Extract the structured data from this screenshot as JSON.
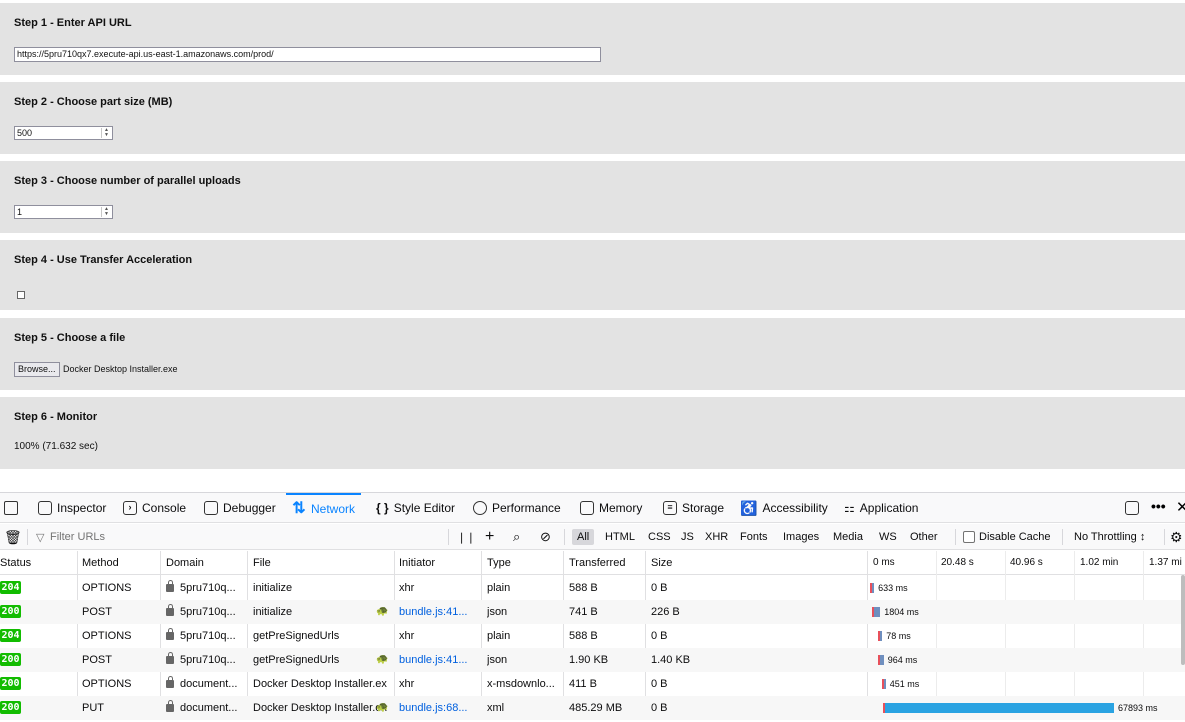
{
  "steps": {
    "s1": {
      "title": "Step 1 - Enter API URL",
      "url_value": "https://5pru710qx7.execute-api.us-east-1.amazonaws.com/prod/"
    },
    "s2": {
      "title": "Step 2 - Choose part size (MB)",
      "value": "500"
    },
    "s3": {
      "title": "Step 3 - Choose number of parallel uploads",
      "value": "1"
    },
    "s4": {
      "title": "Step 4 - Use Transfer Acceleration",
      "checked": false
    },
    "s5": {
      "title": "Step 5 - Choose a file",
      "browse_label": "Browse...",
      "file_name": "Docker Desktop Installer.exe"
    },
    "s6": {
      "title": "Step 6 - Monitor",
      "progress": "100% (71.632 sec)"
    }
  },
  "devtools": {
    "tabs": {
      "inspector": "Inspector",
      "console": "Console",
      "debugger": "Debugger",
      "network": "Network",
      "style_editor": "Style Editor",
      "performance": "Performance",
      "memory": "Memory",
      "storage": "Storage",
      "accessibility": "Accessibility",
      "application": "Application"
    },
    "toolbar": {
      "filter_placeholder": "Filter URLs",
      "types": {
        "all": "All",
        "html": "HTML",
        "css": "CSS",
        "js": "JS",
        "xhr": "XHR",
        "fonts": "Fonts",
        "images": "Images",
        "media": "Media",
        "ws": "WS",
        "other": "Other"
      },
      "disable_cache": "Disable Cache",
      "throttling": "No Throttling ↕"
    },
    "columns": {
      "status": "Status",
      "method": "Method",
      "domain": "Domain",
      "file": "File",
      "initiator": "Initiator",
      "type": "Type",
      "transferred": "Transferred",
      "size": "Size"
    },
    "waterfall_ticks": {
      "t0": "0 ms",
      "t1": "20.48 s",
      "t2": "40.96 s",
      "t3": "1.02 min",
      "t4": "1.37 mi"
    },
    "rows": [
      {
        "status": "204",
        "method": "OPTIONS",
        "domain": "5pru710q...",
        "file": "initialize",
        "initiator": "xhr",
        "type": "plain",
        "transferred": "588 B",
        "size": "0 B",
        "timing": "633 ms"
      },
      {
        "status": "200",
        "method": "POST",
        "domain": "5pru710q...",
        "file": "initialize",
        "initiator": "bundle.js:41...",
        "type": "json",
        "transferred": "741 B",
        "size": "226 B",
        "timing": "1804 ms"
      },
      {
        "status": "204",
        "method": "OPTIONS",
        "domain": "5pru710q...",
        "file": "getPreSignedUrls",
        "initiator": "xhr",
        "type": "plain",
        "transferred": "588 B",
        "size": "0 B",
        "timing": "78 ms"
      },
      {
        "status": "200",
        "method": "POST",
        "domain": "5pru710q...",
        "file": "getPreSignedUrls",
        "initiator": "bundle.js:41...",
        "type": "json",
        "transferred": "1.90 KB",
        "size": "1.40 KB",
        "timing": "964 ms"
      },
      {
        "status": "200",
        "method": "OPTIONS",
        "domain": "document...",
        "file": "Docker Desktop Installer.ex",
        "initiator": "xhr",
        "type": "x-msdownlo...",
        "transferred": "411 B",
        "size": "0 B",
        "timing": "451 ms"
      },
      {
        "status": "200",
        "method": "PUT",
        "domain": "document...",
        "file": "Docker Desktop Installer.ex",
        "initiator": "bundle.js:68...",
        "type": "xml",
        "transferred": "485.29 MB",
        "size": "0 B",
        "timing": "67893 ms"
      }
    ],
    "colors": {
      "accent": "#0a84ff",
      "status_ok": "#12bc00",
      "wait_bar": "#e8505b",
      "recv_bar": "#2aa3e2"
    }
  }
}
